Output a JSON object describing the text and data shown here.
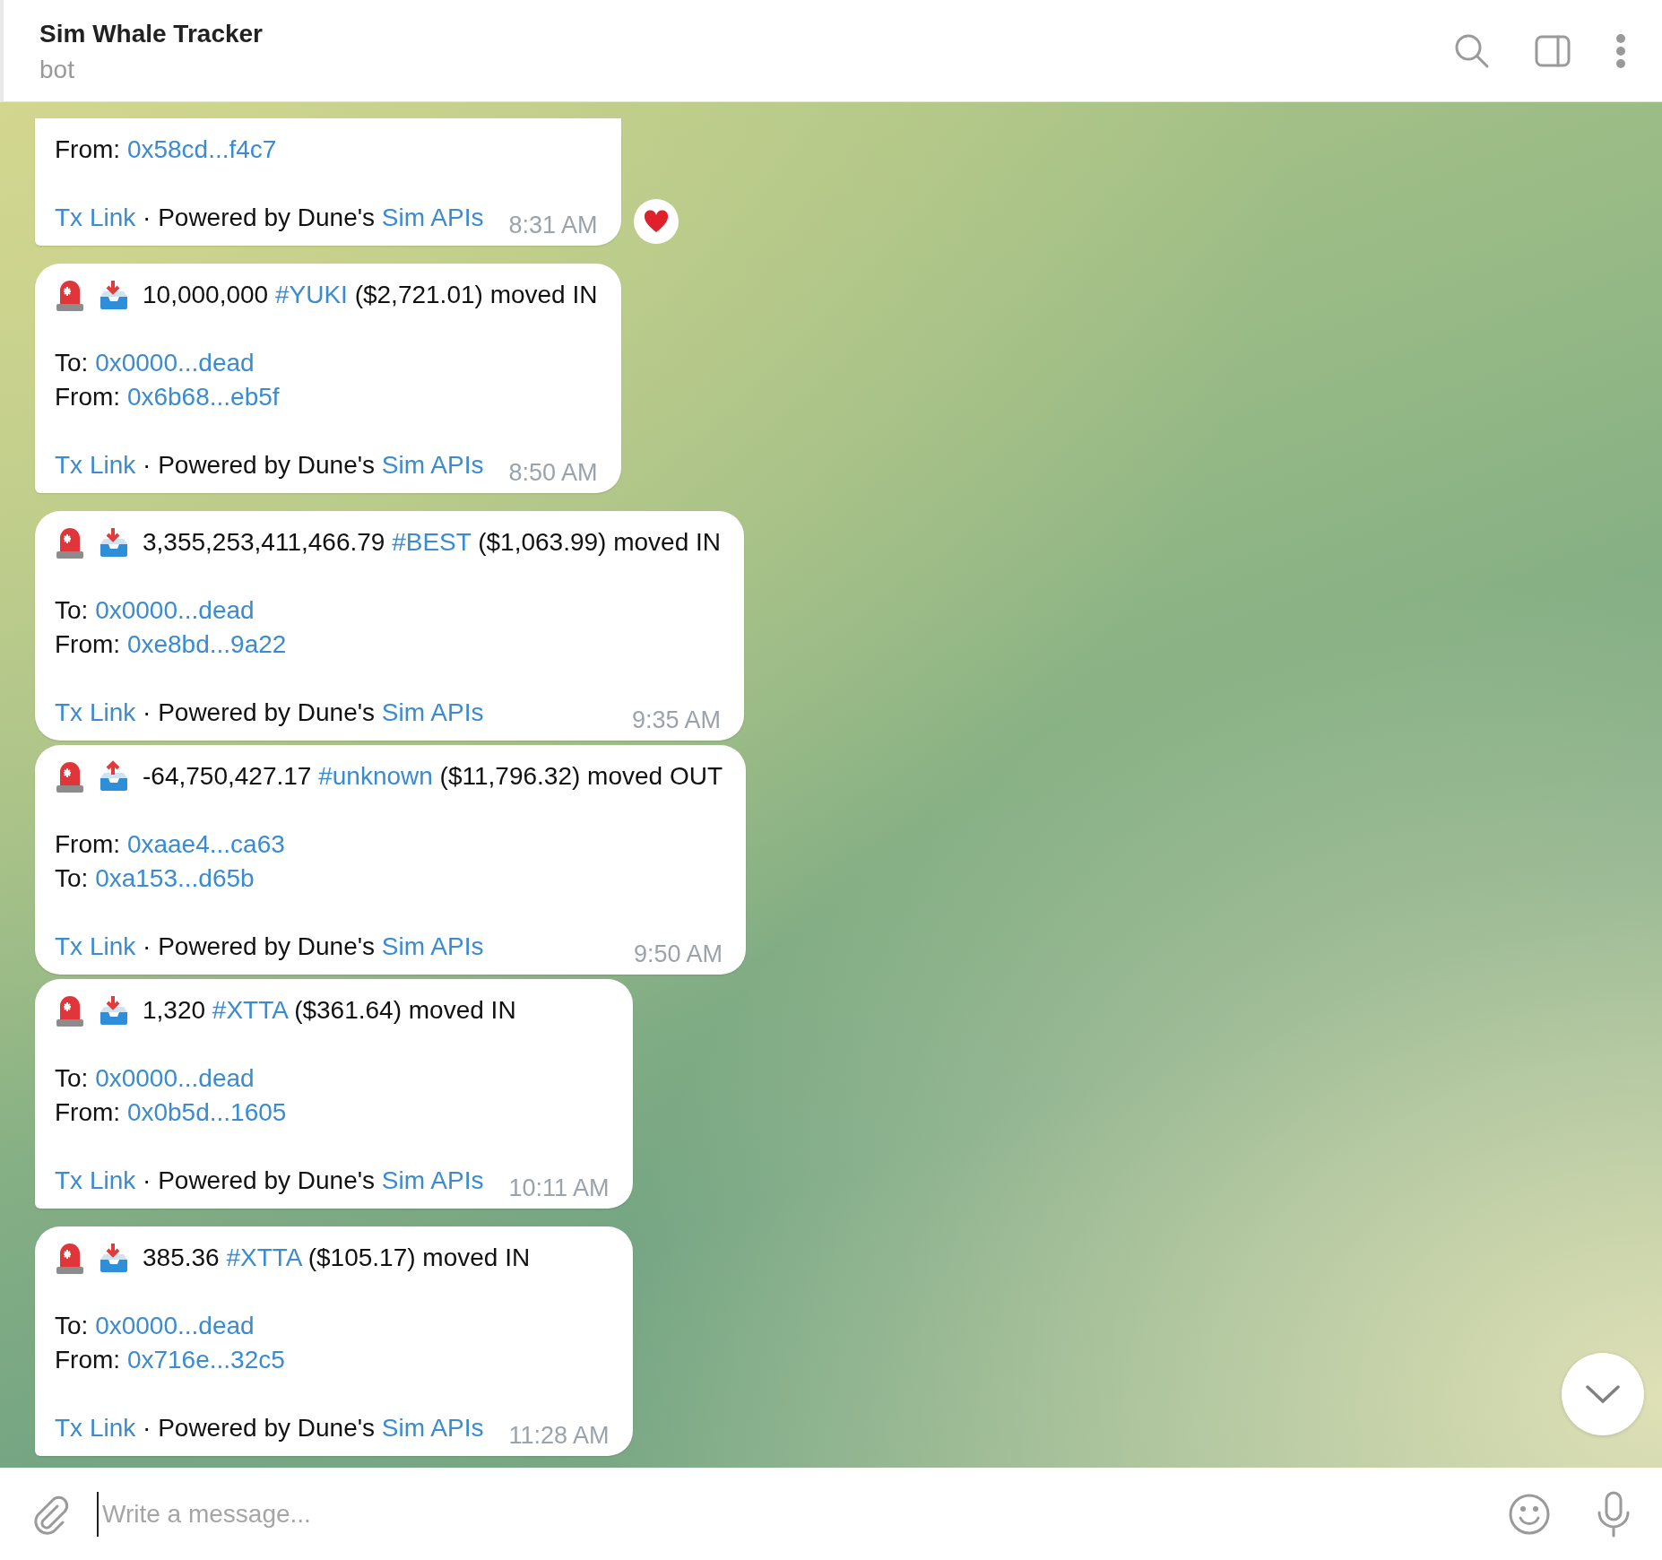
{
  "header": {
    "title": "Sim Whale Tracker",
    "subtitle": "bot"
  },
  "messages": [
    {
      "kind": "in",
      "tail": true,
      "lines": [
        {
          "label": "From:",
          "address": "0x58cd...f4c7"
        }
      ],
      "footer": {
        "link": "Tx Link",
        "text": " · Powered by Dune's ",
        "api_link": "Sim APIs"
      },
      "time": "8:31 AM",
      "reaction": {
        "kind": "heart"
      }
    },
    {
      "kind": "in",
      "tail": true,
      "headline": {
        "amount": "10,000,000",
        "tag": "#YUKI",
        "rest": "($2,721.01) moved IN"
      },
      "lines": [
        {
          "label": "To:",
          "address": "0x0000...dead"
        },
        {
          "label": "From:",
          "address": "0x6b68...eb5f"
        }
      ],
      "footer": {
        "link": "Tx Link",
        "text": " · Powered by Dune's ",
        "api_link": "Sim APIs"
      },
      "time": "8:50 AM"
    },
    {
      "kind": "in",
      "tail": false,
      "headline": {
        "amount": "3,355,253,411,466.79",
        "tag": "#BEST",
        "rest": "($1,063.99) moved IN"
      },
      "lines": [
        {
          "label": "To:",
          "address": "0x0000...dead"
        },
        {
          "label": "From:",
          "address": "0xe8bd...9a22"
        }
      ],
      "footer": {
        "link": "Tx Link",
        "text": " · Powered by Dune's ",
        "api_link": "Sim APIs"
      },
      "time": "9:35 AM"
    },
    {
      "kind": "out",
      "tail": false,
      "headline": {
        "amount": "-64,750,427.17",
        "tag": "#unknown",
        "rest": "($11,796.32) moved OUT"
      },
      "lines": [
        {
          "label": "From:",
          "address": "0xaae4...ca63"
        },
        {
          "label": "To:",
          "address": "0xa153...d65b"
        }
      ],
      "footer": {
        "link": "Tx Link",
        "text": " · Powered by Dune's ",
        "api_link": "Sim APIs"
      },
      "time": "9:50 AM"
    },
    {
      "kind": "in",
      "tail": true,
      "headline": {
        "amount": "1,320",
        "tag": "#XTTA",
        "rest": "($361.64) moved IN"
      },
      "lines": [
        {
          "label": "To:",
          "address": "0x0000...dead"
        },
        {
          "label": "From:",
          "address": "0x0b5d...1605"
        }
      ],
      "footer": {
        "link": "Tx Link",
        "text": " · Powered by Dune's ",
        "api_link": "Sim APIs"
      },
      "time": "10:11 AM"
    },
    {
      "kind": "in",
      "tail": true,
      "headline": {
        "amount": "385.36",
        "tag": "#XTTA",
        "rest": "($105.17) moved IN"
      },
      "lines": [
        {
          "label": "To:",
          "address": "0x0000...dead"
        },
        {
          "label": "From:",
          "address": "0x716e...32c5"
        }
      ],
      "footer": {
        "link": "Tx Link",
        "text": " · Powered by Dune's ",
        "api_link": "Sim APIs"
      },
      "time": "11:28 AM"
    }
  ],
  "composer": {
    "placeholder": "Write a message..."
  }
}
